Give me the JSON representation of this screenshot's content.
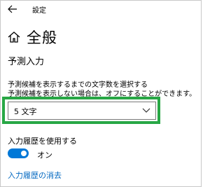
{
  "window": {
    "title": "設定"
  },
  "header": {
    "page_title": "全般",
    "section_title": "予測入力"
  },
  "description": {
    "line1": "予測候補を表示するまでの文字数を選択する",
    "line2": "予測候補を表示しない場合は、オフにすることができます。"
  },
  "dropdown": {
    "selected": "5 文字"
  },
  "history": {
    "label": "入力履歴を使用する",
    "toggle_state": "オン",
    "toggle_on": true
  },
  "link": {
    "clear_history": "入力履歴の消去"
  },
  "colors": {
    "accent": "#0078d7",
    "highlight": "#28a745",
    "link": "#0067c0"
  },
  "icons": {
    "back": "back-arrow-icon",
    "home": "home-icon",
    "dropdown": "chevron-down-icon"
  }
}
